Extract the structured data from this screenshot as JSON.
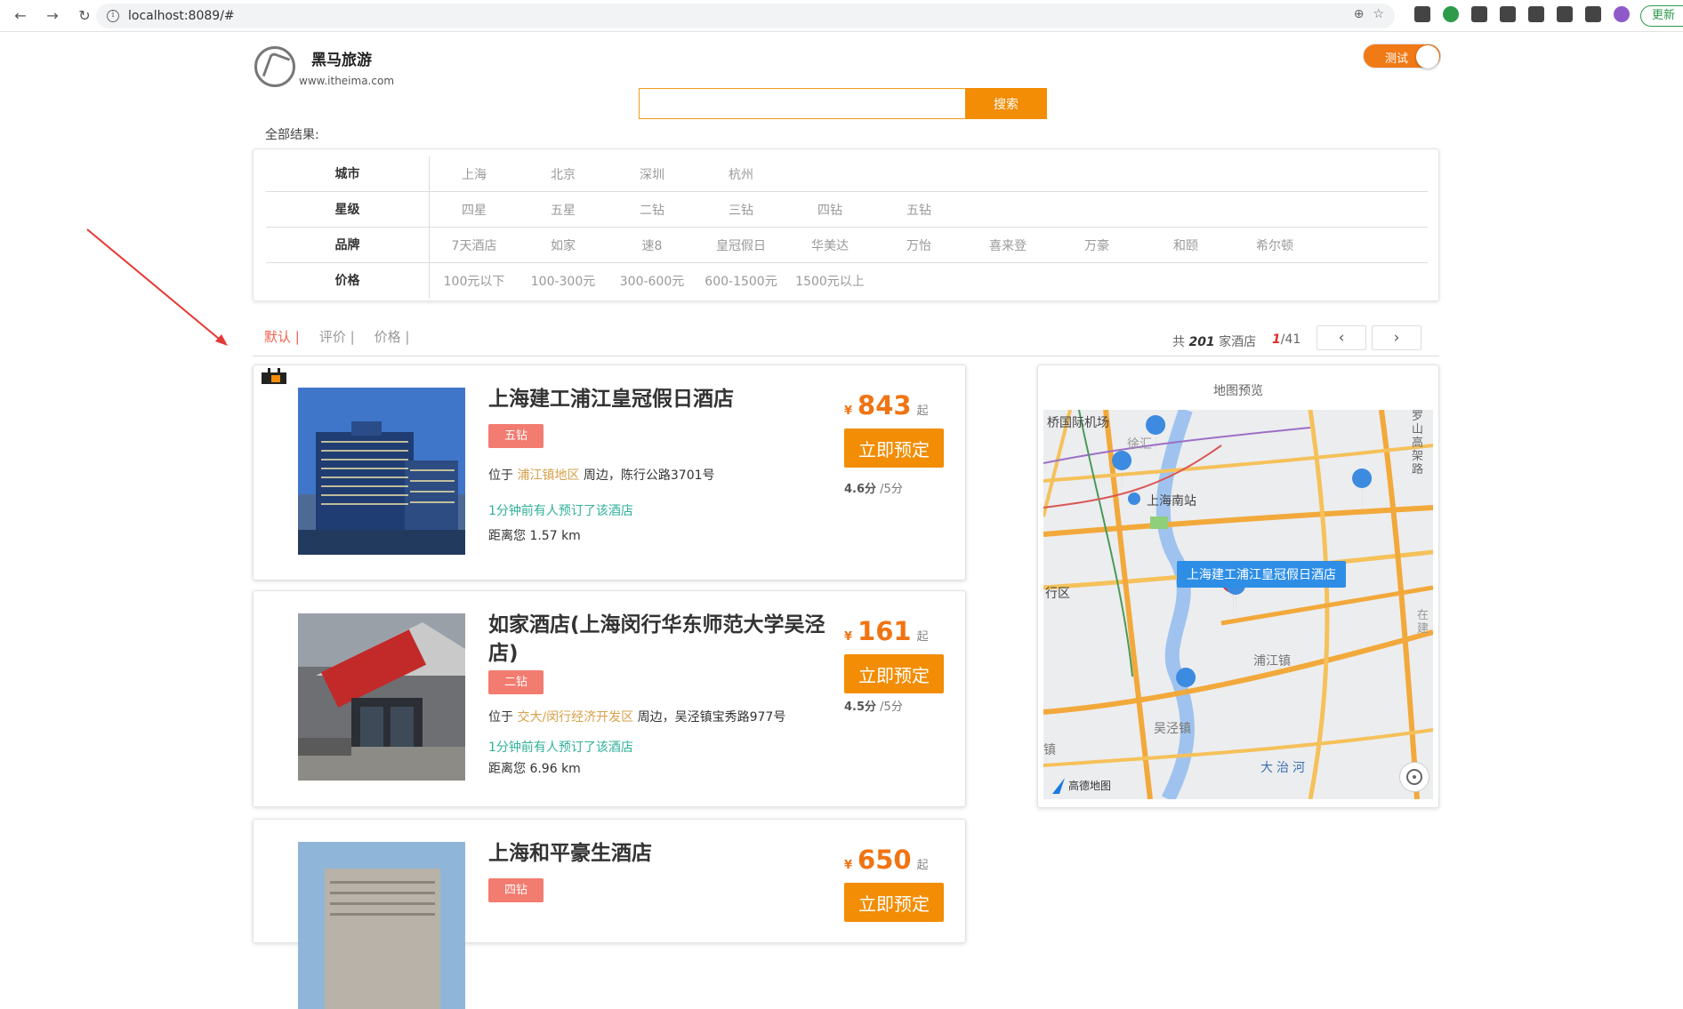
{
  "browser": {
    "url": "localhost:8089/#",
    "update_label": "更新"
  },
  "header": {
    "logo_title": "黑马旅游",
    "logo_sub": "www.itheima.com",
    "toggle_label": "测试",
    "search_placeholder": "",
    "search_button": "搜索",
    "results_label": "全部结果:"
  },
  "filters": [
    {
      "key": "城市",
      "values": [
        "上海",
        "北京",
        "深圳",
        "杭州"
      ]
    },
    {
      "key": "星级",
      "values": [
        "四星",
        "五星",
        "二钻",
        "三钻",
        "四钻",
        "五钻"
      ]
    },
    {
      "key": "品牌",
      "values": [
        "7天酒店",
        "如家",
        "速8",
        "皇冠假日",
        "华美达",
        "万怡",
        "喜来登",
        "万豪",
        "和颐",
        "希尔顿"
      ]
    },
    {
      "key": "价格",
      "values": [
        "100元以下",
        "100-300元",
        "300-600元",
        "600-1500元",
        "1500元以上"
      ]
    }
  ],
  "sort": {
    "options": [
      "默认 |",
      "评价 |",
      "价格 |"
    ],
    "count_prefix": "共 ",
    "count": "201",
    "count_suffix": " 家酒店",
    "page_current": "1",
    "page_total": "/41",
    "prev": "‹",
    "next": "›"
  },
  "hotels": [
    {
      "name": "上海建工浦江皇冠假日酒店",
      "tag": "五钻",
      "loc_prefix": "位于 ",
      "area": "浦江镇地区",
      "loc_suffix": " 周边，陈行公路3701号",
      "recent": "1分钟前有人预订了该酒店",
      "distance": "距离您 1.57 km",
      "currency": "¥",
      "price": "843",
      "price_unit": "起",
      "book_label": "立即预定",
      "score": "4.6分",
      "score_max": " /5分"
    },
    {
      "name": "如家酒店(上海闵行华东师范大学吴泾店)",
      "tag": "二钻",
      "loc_prefix": "位于 ",
      "area": "交大/闵行经济开发区",
      "loc_suffix": " 周边，吴泾镇宝秀路977号",
      "recent": "1分钟前有人预订了该酒店",
      "distance": "距离您 6.96 km",
      "currency": "¥",
      "price": "161",
      "price_unit": "起",
      "book_label": "立即预定",
      "score": "4.5分",
      "score_max": " /5分"
    },
    {
      "name": "上海和平豪生酒店",
      "tag": "四钻",
      "currency": "¥",
      "price": "650",
      "price_unit": "起",
      "book_label": "立即预定"
    }
  ],
  "map": {
    "title": "地图预览",
    "popup": "上海建工浦江皇冠假日酒店",
    "labels": [
      "桥国际机场",
      "上海南站",
      "行区",
      "浦江镇",
      "吴泾镇",
      "大治河",
      "罗山高架路",
      "徐汇",
      "镇",
      "在建"
    ],
    "credit": "高德地图"
  },
  "colors": {
    "accent": "#f28d05",
    "tag": "#f37c71",
    "active_sort": "#f0614e",
    "recent": "#2fb09a",
    "area": "#d7a14a",
    "map_popup": "#2e8ee6"
  }
}
